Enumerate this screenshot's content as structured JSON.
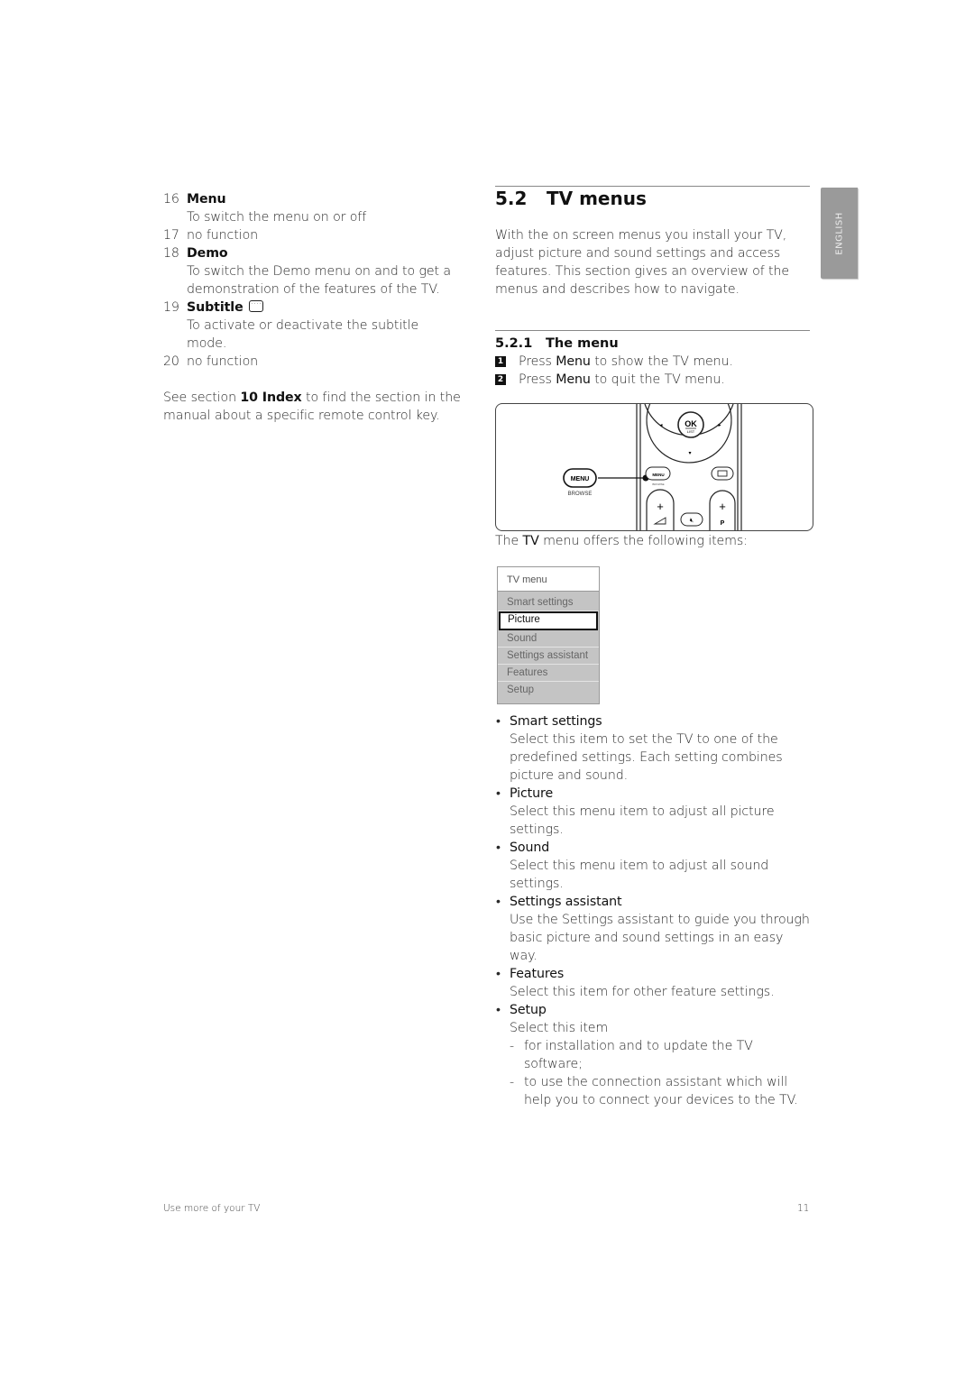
{
  "left_column": {
    "items": [
      {
        "num": "16",
        "title": "Menu",
        "desc": "To switch the menu on or off"
      },
      {
        "num": "17",
        "title": "no function",
        "desc": ""
      },
      {
        "num": "18",
        "title": "Demo",
        "desc": "To switch the Demo menu on and to get a demonstration of the features of the TV."
      },
      {
        "num": "19",
        "title": "Subtitle",
        "icon": "subtitle-icon",
        "desc": "To activate or deactivate the subtitle mode."
      },
      {
        "num": "20",
        "title": "no function",
        "desc": ""
      }
    ],
    "see_section": {
      "prefix": "See section ",
      "ref": "10 Index",
      "suffix": " to find the section in the manual about a specific remote control key."
    }
  },
  "section": {
    "number": "5.2",
    "title": "TV menus",
    "intro": "With the on screen menus you install your TV, adjust picture and sound settings and access features. This section gives an overview of the menus and describes how to navigate."
  },
  "subsection": {
    "number": "5.2.1",
    "title": "The menu",
    "steps": [
      {
        "badge": "1",
        "pre": "Press ",
        "key": "Menu",
        "post": " to show the TV menu."
      },
      {
        "badge": "2",
        "pre": "Press ",
        "key": "Menu",
        "post": " to quit the TV menu."
      }
    ]
  },
  "remote": {
    "menu_button": "MENU",
    "browse_label": "BROWSE",
    "ok_label": "OK",
    "list_label": "LIST",
    "small_menu": "MENU",
    "small_browse": "BROWSE",
    "p_label": "P",
    "plus": "+"
  },
  "caption": {
    "pre": "The ",
    "key": "TV",
    "post": " menu offers the following items:"
  },
  "tv_menu": {
    "header": "TV menu",
    "items": [
      {
        "label": "Smart settings",
        "selected": false
      },
      {
        "label": "Picture",
        "selected": true
      },
      {
        "label": "Sound",
        "selected": false
      },
      {
        "label": "Settings assistant",
        "selected": false
      },
      {
        "label": "Features",
        "selected": false
      },
      {
        "label": "Setup",
        "selected": false
      }
    ]
  },
  "bullets": [
    {
      "title": "Smart settings",
      "desc": "Select this item to set the TV to one of the predefined settings. Each setting combines picture and sound."
    },
    {
      "title": "Picture",
      "desc": "Select this menu item to adjust all picture settings."
    },
    {
      "title": "Sound",
      "desc": "Select this menu item to adjust all sound settings."
    },
    {
      "title": "Settings assistant",
      "desc": "Use the Settings assistant to guide you through basic picture and sound settings in an easy way."
    },
    {
      "title": "Features",
      "desc": "Select this item for other feature settings."
    },
    {
      "title": "Setup",
      "desc": "Select this item",
      "sub": [
        "for installation and to update the TV software;",
        "to use the connection assistant which will help you to connect your devices to the TV."
      ]
    }
  ],
  "side_tab": {
    "label": "ENGLISH"
  },
  "footer": {
    "left": "Use more of your TV",
    "page": "11"
  }
}
